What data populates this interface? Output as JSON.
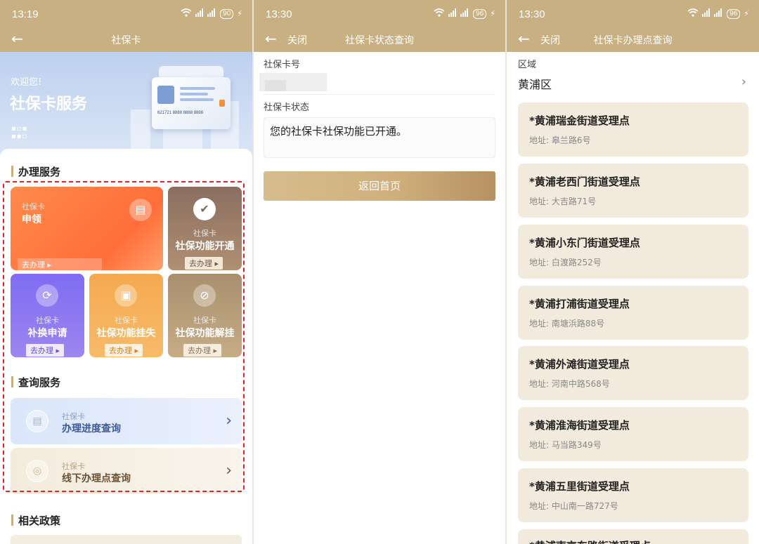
{
  "status": {
    "p1_time": "13:19",
    "p1_battery": "90",
    "p2_time": "13:30",
    "p2_battery": "96",
    "p3_time": "13:30",
    "p3_battery": "96"
  },
  "panel1": {
    "nav_title": "社保卡",
    "banner": {
      "welcome": "欢迎您!",
      "title": "社保卡服务",
      "card_number": "621721 8888 8888 8888"
    },
    "section_handle": "办理服务",
    "tiles": [
      {
        "sub": "社保卡",
        "name": "申领",
        "go": "去办理 ▸"
      },
      {
        "sub": "社保卡",
        "name": "社保功能开通",
        "go": "去办理 ▸"
      },
      {
        "sub": "社保卡",
        "name": "补换申请",
        "go": "去办理 ▸"
      },
      {
        "sub": "社保卡",
        "name": "社保功能挂失",
        "go": "去办理 ▸"
      },
      {
        "sub": "社保卡",
        "name": "社保功能解挂",
        "go": "去办理 ▸"
      }
    ],
    "section_query": "查询服务",
    "queries": [
      {
        "sub": "社保卡",
        "name": "办理进度查询"
      },
      {
        "sub": "社保卡",
        "name": "线下办理点查询"
      }
    ],
    "section_policy": "相关政策"
  },
  "panel2": {
    "close_label": "关闭",
    "nav_title": "社保卡状态查询",
    "card_no_label": "社保卡号",
    "status_label": "社保卡状态",
    "status_text": "您的社保卡社保功能已开通。",
    "home_button": "返回首页"
  },
  "panel3": {
    "close_label": "关闭",
    "nav_title": "社保卡办理点查询",
    "region_label": "区域",
    "region_value": "黄浦区",
    "address_prefix": "地址:",
    "offices": [
      {
        "name": "*黄浦瑞金街道受理点",
        "address": "皋兰路6号"
      },
      {
        "name": "*黄浦老西门街道受理点",
        "address": "大吉路71号"
      },
      {
        "name": "*黄浦小东门街道受理点",
        "address": "白渡路252号"
      },
      {
        "name": "*黄浦打浦街道受理点",
        "address": "南塘浜路88号"
      },
      {
        "name": "*黄浦外滩街道受理点",
        "address": "河南中路568号"
      },
      {
        "name": "*黄浦淮海街道受理点",
        "address": "马当路349号"
      },
      {
        "name": "*黄浦五里街道受理点",
        "address": "中山南一路727号"
      },
      {
        "name": "*黄浦南京东路街道受理点",
        "address": ""
      }
    ]
  },
  "colors": {
    "header": "#c8b083",
    "accent_orange": "#ff7a3d",
    "accent_purple": "#8b6ff0",
    "accent_gold": "#f2a54a",
    "accent_brown": "#a88f6e",
    "dashed_box": "#e02424"
  }
}
